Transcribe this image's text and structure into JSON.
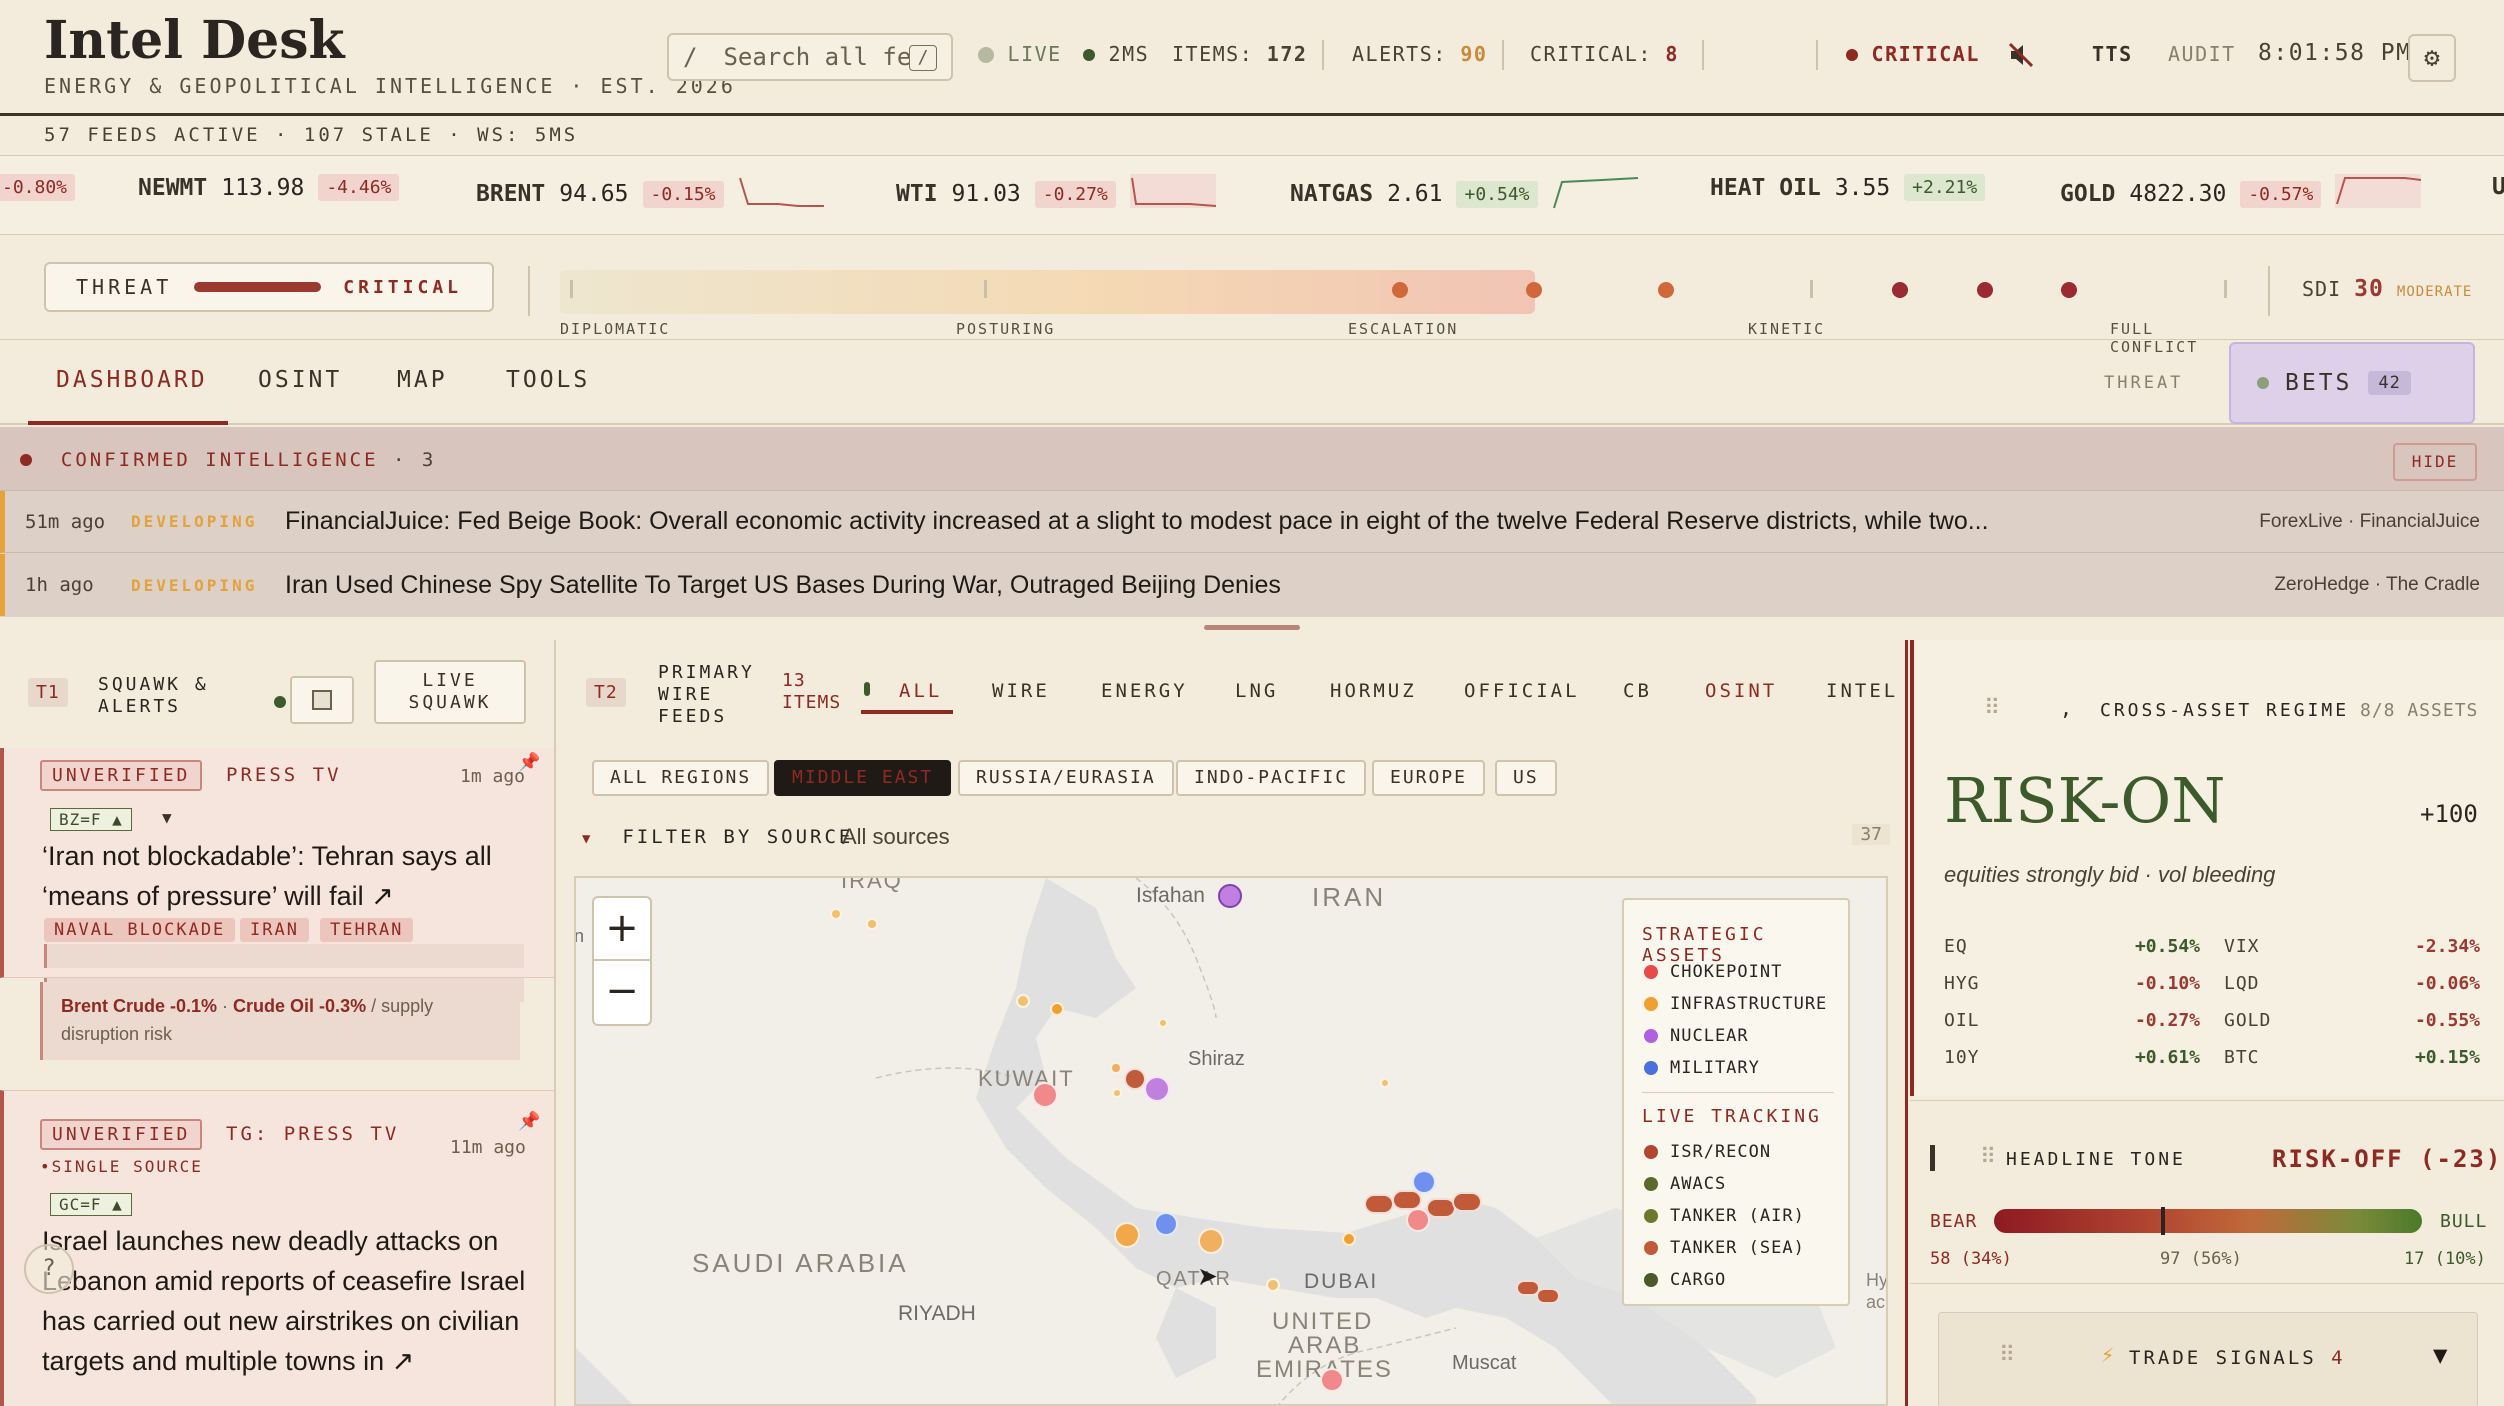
{
  "header": {
    "brand": "Intel Desk",
    "tagline": "ENERGY & GEOPOLITICAL INTELLIGENCE · EST. 2026",
    "search_placeholder": "Search all fe",
    "search_kbd": "/",
    "search_slash": "/",
    "live": "LIVE",
    "latency": "2MS",
    "items_label": "ITEMS:",
    "items": "172",
    "alerts_label": "ALERTS:",
    "alerts": "90",
    "critical_label": "CRITICAL:",
    "critical": "8",
    "status": "CRITICAL",
    "tts": "TTS",
    "audit": "AUDIT",
    "time": "8:01:58 PM",
    "colors": {
      "accent": "#8e2a22",
      "green": "#3d5a2a",
      "amber": "#e2a23e"
    }
  },
  "feeds_bar": "57 FEEDS ACTIVE · 107 STALE · WS: 5MS",
  "ticker": [
    {
      "symbol": "",
      "price": "",
      "change": "-0.80%"
    },
    {
      "symbol": "NEWMT",
      "price": "113.98",
      "change": "-4.46%"
    },
    {
      "symbol": "BRENT",
      "price": "94.65",
      "change": "-0.15%"
    },
    {
      "symbol": "WTI",
      "price": "91.03",
      "change": "-0.27%"
    },
    {
      "symbol": "NATGAS",
      "price": "2.61",
      "change": "+0.54%"
    },
    {
      "symbol": "HEAT OIL",
      "price": "3.55",
      "change": "+2.21%"
    },
    {
      "symbol": "GOLD",
      "price": "4822.30",
      "change": "-0.57%"
    },
    {
      "symbol": "U",
      "price": "",
      "change": ""
    }
  ],
  "threat": {
    "label": "THREAT",
    "level": "CRITICAL",
    "scale_labels": [
      "DIPLOMATIC",
      "POSTURING",
      "ESCALATION",
      "KINETIC",
      "FULL CONFLICT"
    ],
    "sdi_label": "SDI",
    "sdi_value": "30",
    "sdi_level": "MODERATE"
  },
  "tabs": [
    "DASHBOARD",
    "OSINT",
    "MAP",
    "TOOLS"
  ],
  "threat_tab": "THREAT",
  "bets": {
    "label": "BETS",
    "count": "42"
  },
  "confirmed": {
    "title": "CONFIRMED INTELLIGENCE",
    "count": "· 3",
    "hide": "HIDE",
    "rows": [
      {
        "ago": "51m ago",
        "status": "DEVELOPING",
        "headline": "FinancialJuice: Fed Beige Book: Overall economic activity increased at a slight to modest pace in eight of the twelve Federal Reserve districts, while two...",
        "source": "ForexLive · FinancialJuice"
      },
      {
        "ago": "1h ago",
        "status": "DEVELOPING",
        "headline": "Iran Used Chinese Spy Satellite To Target US Bases During War, Outraged Beijing Denies",
        "source": "ZeroHedge · The Cradle"
      }
    ]
  },
  "squawk": {
    "badge": "T1",
    "title_l1": "SQUAWK &",
    "title_l2": "ALERTS",
    "live_l1": "LIVE",
    "live_l2": "SQUAWK",
    "cards": [
      {
        "badge": "UNVERIFIED",
        "source": "PRESS TV",
        "ago": "1m ago",
        "tag": "BZ=F ▲",
        "title": "‘Iran not blockadable’: Tehran says all ‘means of pressure’ will fail ↗",
        "chips": [
          "NAVAL BLOCKADE",
          "IRAN",
          "TEHRAN"
        ],
        "note_a": "Brent Crude -0.1%",
        "note_sep": " · ",
        "note_b": "Crude Oil -0.3%",
        "note_rest": " / supply disruption risk"
      },
      {
        "badge": "UNVERIFIED",
        "source": "TG: PRESS TV",
        "ago": "11m ago",
        "sub": "•SINGLE SOURCE",
        "tag": "GC=F ▲",
        "title": "Israel launches new deadly attacks on Lebanon amid reports of ceasefire Israel has carried out new airstrikes on civilian targets and multiple towns in ↗"
      }
    ]
  },
  "wire": {
    "badge": "T2",
    "title_l1": "PRIMARY",
    "title_l2": "WIRE",
    "title_l3": "FEEDS",
    "items_l1": "13",
    "items_l2": "ITEMS",
    "tabs": [
      "ALL",
      "WIRE",
      "ENERGY",
      "LNG",
      "HORMUZ",
      "OFFICIAL",
      "CB",
      "OSINT",
      "INTEL"
    ],
    "regions": [
      "ALL REGIONS",
      "MIDDLE EAST",
      "RUSSIA/EURASIA",
      "INDO-PACIFIC",
      "EUROPE",
      "US"
    ],
    "filter_label": "FILTER BY SOURCE",
    "filter_value": "All sources",
    "filter_count": "37"
  },
  "map": {
    "places": [
      "IRAQ",
      "Isfahan",
      "IRAN",
      "KUWAIT",
      "Shiraz",
      "SAUDI ARABIA",
      "QATAR",
      "DUBAI",
      "RIYADH",
      "UNITED",
      "ARAB",
      "EMIRATES",
      "Muscat",
      "n",
      "Hy",
      "ac"
    ],
    "legend": {
      "strategic_title": "STRATEGIC ASSETS",
      "strategic": [
        {
          "name": "CHOKEPOINT",
          "color": "#e84a4a"
        },
        {
          "name": "INFRASTRUCTURE",
          "color": "#f0a030"
        },
        {
          "name": "NUCLEAR",
          "color": "#b060e0"
        },
        {
          "name": "MILITARY",
          "color": "#4a70e0"
        }
      ],
      "tracking_title": "LIVE TRACKING",
      "tracking": [
        {
          "name": "ISR/RECON",
          "color": "#b0482f"
        },
        {
          "name": "AWACS",
          "color": "#5a6a2a"
        },
        {
          "name": "TANKER (AIR)",
          "color": "#6a7a2a"
        },
        {
          "name": "TANKER (SEA)",
          "color": "#c05a38"
        },
        {
          "name": "CARGO",
          "color": "#4a5a28"
        }
      ]
    }
  },
  "regime": {
    "prefix": ",",
    "title": "CROSS-ASSET REGIME",
    "assets": "8/8 ASSETS",
    "state": "RISK-ON",
    "score": "+100",
    "desc": "equities strongly bid · vol bleeding",
    "rows": [
      {
        "a": "EQ",
        "av": "+0.54%",
        "b": "VIX",
        "bv": "-2.34%"
      },
      {
        "a": "HYG",
        "av": "-0.10%",
        "b": "LQD",
        "bv": "-0.06%"
      },
      {
        "a": "OIL",
        "av": "-0.27%",
        "b": "GOLD",
        "bv": "-0.55%"
      },
      {
        "a": "10Y",
        "av": "+0.61%",
        "b": "BTC",
        "bv": "+0.15%"
      }
    ]
  },
  "tone": {
    "title": "HEADLINE TONE",
    "value": "RISK-OFF (-23)",
    "bear": "BEAR",
    "bull": "BULL",
    "bear_count": "58 (34%)",
    "neutral_count": "97 (56%)",
    "bull_count": "17 (10%)",
    "marker_fraction": 0.39
  },
  "signals": {
    "title": "TRADE SIGNALS",
    "count": "4"
  }
}
